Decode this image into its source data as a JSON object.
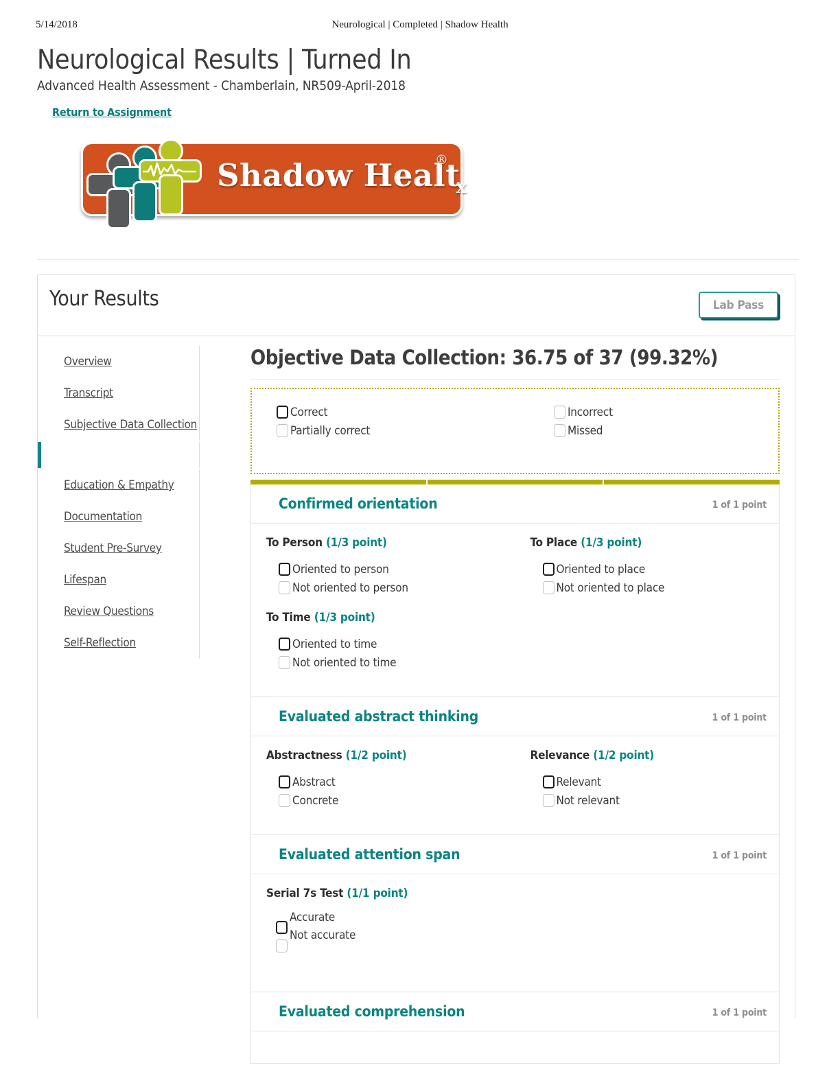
{
  "print_header": {
    "date": "5/14/2018",
    "title": "Neurological | Completed | Shadow Health"
  },
  "page": {
    "title": "Neurological Results | Turned In",
    "subtitle": "Advanced Health Assessment - Chamberlain, NR509-April-2018",
    "return_link": "Return to Assignment"
  },
  "logo": {
    "text": "Shadow Healt",
    "x_letter": "x",
    "registered": "®",
    "colors": {
      "plate": "#d2511e",
      "figure_gray": "#58595b",
      "figure_teal": "#0e7c7b",
      "figure_green": "#b5c422"
    }
  },
  "results_card": {
    "heading": "Your Results",
    "lab_pass_label": "Lab Pass"
  },
  "sidebar": {
    "groups": [
      {
        "items": [
          {
            "label": "Overview",
            "active": false
          },
          {
            "label": "Transcript",
            "active": false
          },
          {
            "label": "Subjective Data Collection",
            "active": false
          }
        ]
      },
      {
        "items": [
          {
            "label": "",
            "active": true
          }
        ]
      },
      {
        "items": [
          {
            "label": "Education & Empathy",
            "active": false
          },
          {
            "label": "Documentation",
            "active": false
          },
          {
            "label": "Student Pre-Survey",
            "active": false
          },
          {
            "label": "Lifespan",
            "active": false
          },
          {
            "label": "Review Questions",
            "active": false
          },
          {
            "label": "Self-Reflection",
            "active": false
          }
        ]
      }
    ]
  },
  "objective": {
    "score_heading": "Objective Data Collection: 36.75 of 37 (99.32%)",
    "legend": {
      "col_a": [
        {
          "label": "Correct",
          "state": "bold"
        },
        {
          "label": "Partially correct",
          "state": "light"
        }
      ],
      "col_b": [
        {
          "label": "Incorrect",
          "state": "light"
        },
        {
          "label": "Missed",
          "state": "light"
        }
      ],
      "border_color": "#b3a900"
    },
    "progress_bar_color": "#b3ad00",
    "sections": [
      {
        "title": "Confirmed orientation",
        "points": "1 of 1 point",
        "criteria": [
          {
            "label": "To Person",
            "points": "(1/3 point)",
            "layout": "normal",
            "options": [
              {
                "label": "Oriented to person",
                "state": "bold"
              },
              {
                "label": "Not oriented to person",
                "state": "light"
              }
            ]
          },
          {
            "label": "To Place",
            "points": "(1/3 point)",
            "layout": "normal",
            "options": [
              {
                "label": "Oriented to place",
                "state": "bold"
              },
              {
                "label": "Not oriented to place",
                "state": "light"
              }
            ]
          },
          {
            "label": "To Time",
            "points": "(1/3 point)",
            "layout": "normal",
            "options": [
              {
                "label": "Oriented to  time",
                "state": "bold"
              },
              {
                "label": "Not oriented to time",
                "state": "light"
              }
            ]
          }
        ]
      },
      {
        "title": "Evaluated abstract thinking",
        "points": "1 of 1 point",
        "criteria": [
          {
            "label": "Abstractness",
            "points": "(1/2 point)",
            "layout": "normal",
            "options": [
              {
                "label": "Abstract",
                "state": "bold"
              },
              {
                "label": "Concrete",
                "state": "light"
              }
            ]
          },
          {
            "label": "Relevance",
            "points": "(1/2 point)",
            "layout": "normal",
            "options": [
              {
                "label": "Relevant",
                "state": "bold"
              },
              {
                "label": "Not relevant",
                "state": "light"
              }
            ]
          }
        ]
      },
      {
        "title": "Evaluated attention span",
        "points": "1 of 1 point",
        "criteria": [
          {
            "label": "Serial 7s Test",
            "points": "(1/1 point)",
            "layout": "offset",
            "options": [
              {
                "label": "Accurate",
                "state": "bold"
              },
              {
                "label": "Not accurate",
                "state": "light"
              }
            ]
          }
        ]
      },
      {
        "title": "Evaluated comprehension",
        "points": "1 of 1 point",
        "criteria": []
      }
    ]
  }
}
